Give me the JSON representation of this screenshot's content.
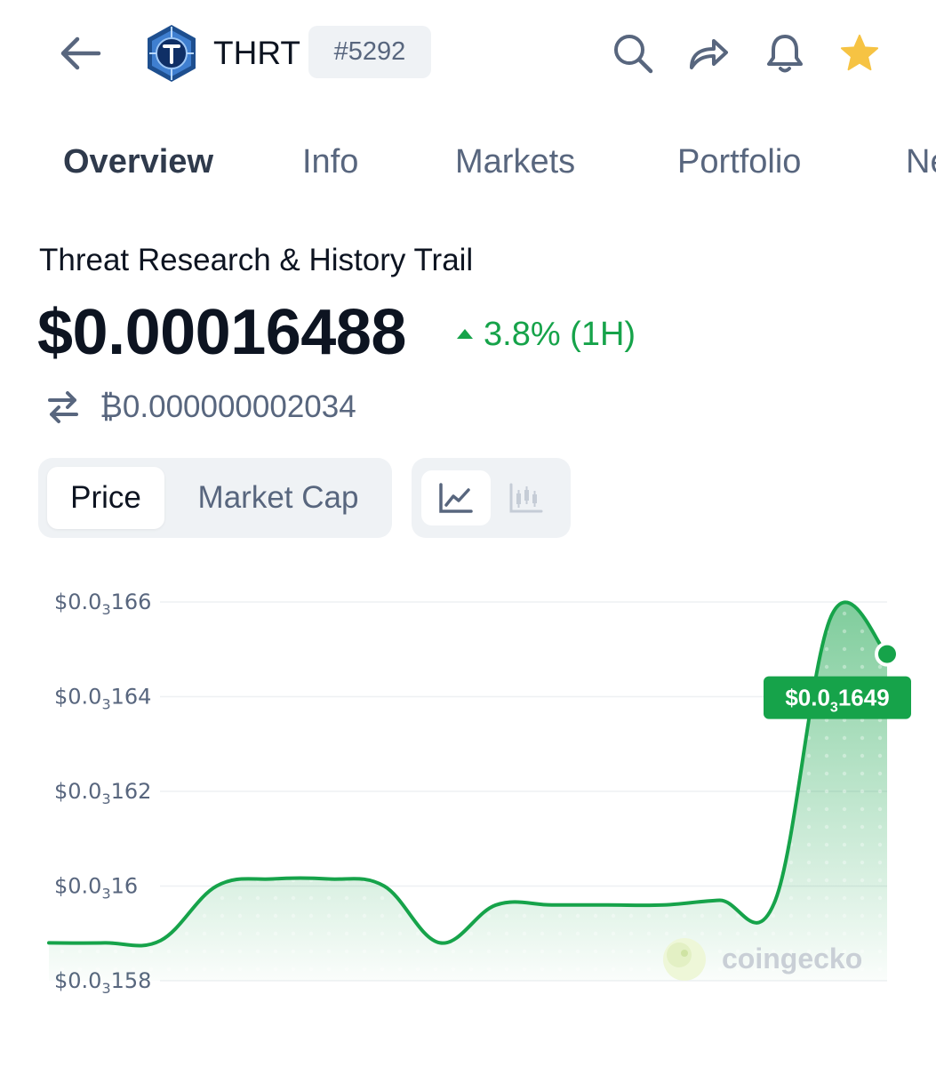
{
  "header": {
    "ticker": "THRT",
    "rank": "#5292",
    "icons": [
      "back-arrow-icon",
      "search-icon",
      "share-icon",
      "bell-icon",
      "star-icon"
    ],
    "star_color": "#f6c343"
  },
  "tabs": [
    {
      "label": "Overview",
      "active": true
    },
    {
      "label": "Info",
      "active": false
    },
    {
      "label": "Markets",
      "active": false
    },
    {
      "label": "Portfolio",
      "active": false
    },
    {
      "label": "Ne",
      "active": false
    }
  ],
  "coin": {
    "name": "Threat Research & History Trail",
    "price": "$0.00016488",
    "change": "3.8% (1H)",
    "btc_price": "₿0.000000002034"
  },
  "toggles": {
    "price_label": "Price",
    "market_cap_label": "Market Cap",
    "line_icon": "line-chart-icon",
    "candle_icon": "candlestick-icon"
  },
  "colors": {
    "accent_green": "#16a34a",
    "text_primary": "#0d1421",
    "text_secondary": "#58667e",
    "surface": "#eff2f5"
  },
  "chart_data": {
    "type": "area",
    "yticks": [
      {
        "value": 0.000166,
        "prefix": "$0.0",
        "sub": "3",
        "suffix": "166"
      },
      {
        "value": 0.000164,
        "prefix": "$0.0",
        "sub": "3",
        "suffix": "164"
      },
      {
        "value": 0.000162,
        "prefix": "$0.0",
        "sub": "3",
        "suffix": "162"
      },
      {
        "value": 0.00016,
        "prefix": "$0.0",
        "sub": "3",
        "suffix": "16"
      },
      {
        "value": 0.000158,
        "prefix": "$0.0",
        "sub": "3",
        "suffix": "158"
      }
    ],
    "ylim": [
      0.000158,
      0.000166
    ],
    "grid": true,
    "values": [
      0.0001588,
      0.0001588,
      0.00015885,
      0.00016,
      0.00016015,
      0.00016015,
      0.00016,
      0.0001588,
      0.0001596,
      0.0001596,
      0.0001596,
      0.0001596,
      0.0001597,
      0.0001597,
      0.0001657,
      0.0001649
    ],
    "current_label": {
      "prefix": "$0.0",
      "sub": "3",
      "suffix": "1649"
    },
    "line_color": "#16a34a",
    "watermark": "coingecko"
  }
}
